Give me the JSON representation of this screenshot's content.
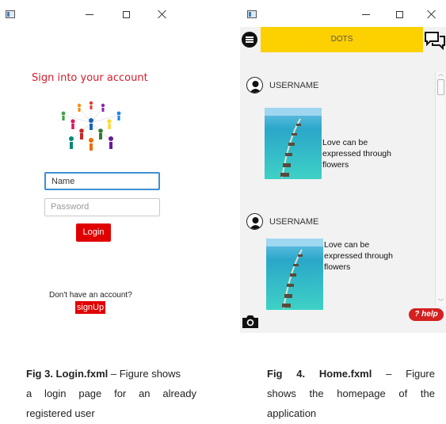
{
  "login_window": {
    "title_label": "Sign into your account",
    "name_placeholder": "Name",
    "password_placeholder": "Password",
    "login_label": "Login",
    "no_account_text": "Don't have an account?",
    "signup_label": "signUp",
    "accent_color": "#e00000"
  },
  "home_window": {
    "app_title": "DOTS",
    "posts": [
      {
        "username": "USERNAME",
        "caption_lines": [
          "Love can be",
          "expressed through",
          "flowers"
        ]
      },
      {
        "username": "USERNAME",
        "caption_lines": [
          "Love can be",
          "expressed through",
          "flowers"
        ]
      }
    ],
    "help_label": "help",
    "topbar_color": "#fdd000"
  },
  "captions": {
    "left": {
      "bold": "Fig 3. Login.fxml",
      "line1_rest": " – Figure shows",
      "line2": "a login page for an already",
      "line3": "registered user"
    },
    "right": {
      "bold": "Fig 4. Home.fxml",
      "line1_rest": " – Figure",
      "line2": "shows the homepage of the",
      "line3": "application"
    }
  }
}
